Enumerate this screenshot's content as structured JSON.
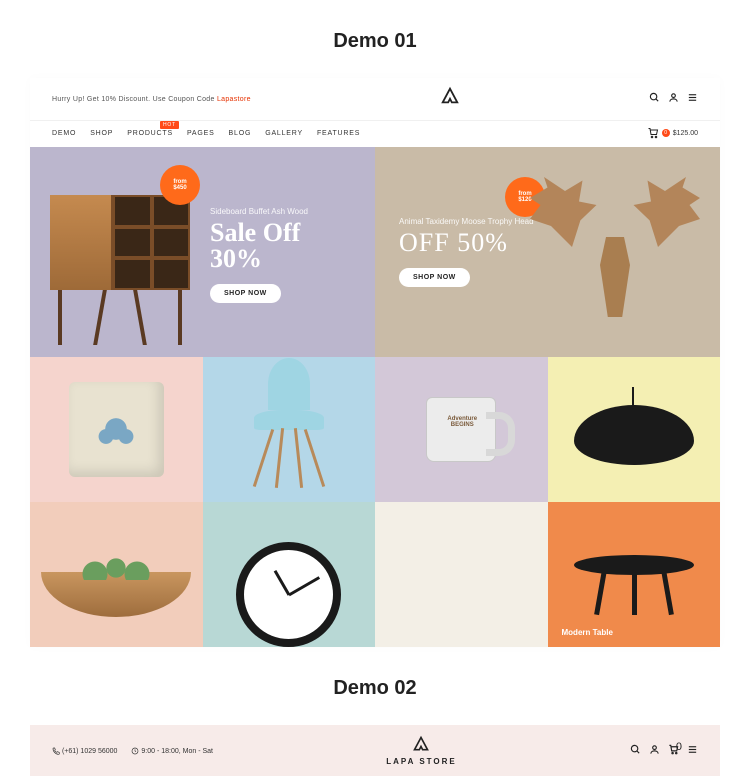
{
  "demo1": {
    "title": "Demo 01",
    "promo_text": "Hurry Up! Get 10% Discount. Use Coupon Code ",
    "promo_code": "Lapastore",
    "nav": [
      "DEMO",
      "SHOP",
      "PRODUCTS",
      "PAGES",
      "BLOG",
      "GALLERY",
      "FEATURES"
    ],
    "nav_hot_label": "HOT",
    "cart_count": "0",
    "cart_total": "$125.00",
    "hero_left": {
      "badge_prefix": "from",
      "badge_price": "$450",
      "subtitle": "Sideboard Buffet Ash Wood",
      "title_l1": "Sale Off",
      "title_l2": "30%",
      "button": "SHOP NOW"
    },
    "hero_right": {
      "badge_prefix": "from",
      "badge_price": "$120",
      "subtitle": "Animal Taxidemy Moose Trophy Head",
      "title": "OFF 50%",
      "button": "SHOP NOW"
    },
    "mug_text_l1": "Adventure",
    "mug_text_l2": "BEGINS",
    "table_label": "Modern Table"
  },
  "demo2": {
    "title": "Demo 02",
    "phone": "(+61) 1029 56000",
    "hours": "9:00 - 18:00, Mon - Sat",
    "store_name": "LAPA STORE",
    "cart_count": "0"
  }
}
